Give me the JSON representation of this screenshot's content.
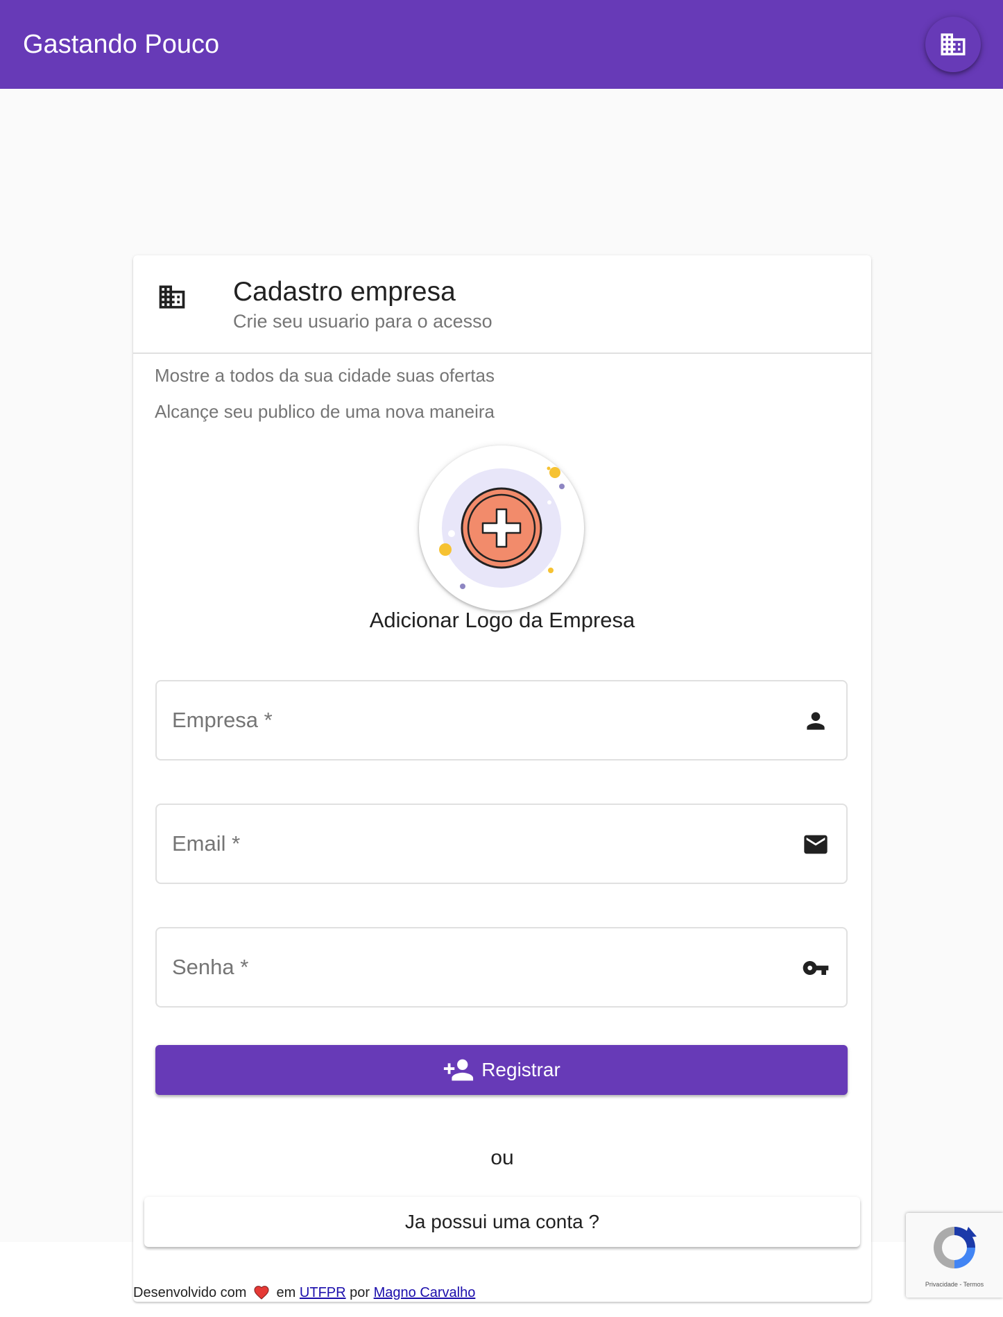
{
  "toolbar": {
    "title": "Gastando Pouco",
    "fab_icon": "business-icon"
  },
  "card": {
    "header_icon": "business-icon",
    "title": "Cadastro empresa",
    "subtitle": "Crie seu usuario para o acesso",
    "info_lines": [
      "Mostre a todos da sua cidade suas ofertas",
      "Alcançe seu publico de uma nova maneira"
    ],
    "logo": {
      "icon": "add-circle-icon",
      "caption": "Adicionar Logo da Empresa"
    },
    "fields": {
      "empresa": {
        "placeholder": "Empresa *",
        "value": "",
        "icon": "person-icon"
      },
      "email": {
        "placeholder": "Email *",
        "value": "",
        "icon": "mail-icon"
      },
      "senha": {
        "placeholder": "Senha *",
        "value": "",
        "icon": "key-icon"
      }
    },
    "register_button": {
      "label": "Registrar",
      "icon": "person-add-icon"
    },
    "or_text": "ou",
    "login_button": {
      "label": "Ja possui uma conta ?"
    }
  },
  "footer": {
    "prefix": "Desenvolvido com",
    "heart_icon": "heart-icon",
    "em": "em",
    "org_link": "UTFPR",
    "por": "por",
    "author_link": "Magno Carvalho"
  },
  "recaptcha": {
    "links": "Privacidade - Termos"
  },
  "colors": {
    "primary": "#673ab7",
    "background": "#fafafa",
    "logo_accent": "#f28b6b",
    "heart": "#e53935"
  }
}
